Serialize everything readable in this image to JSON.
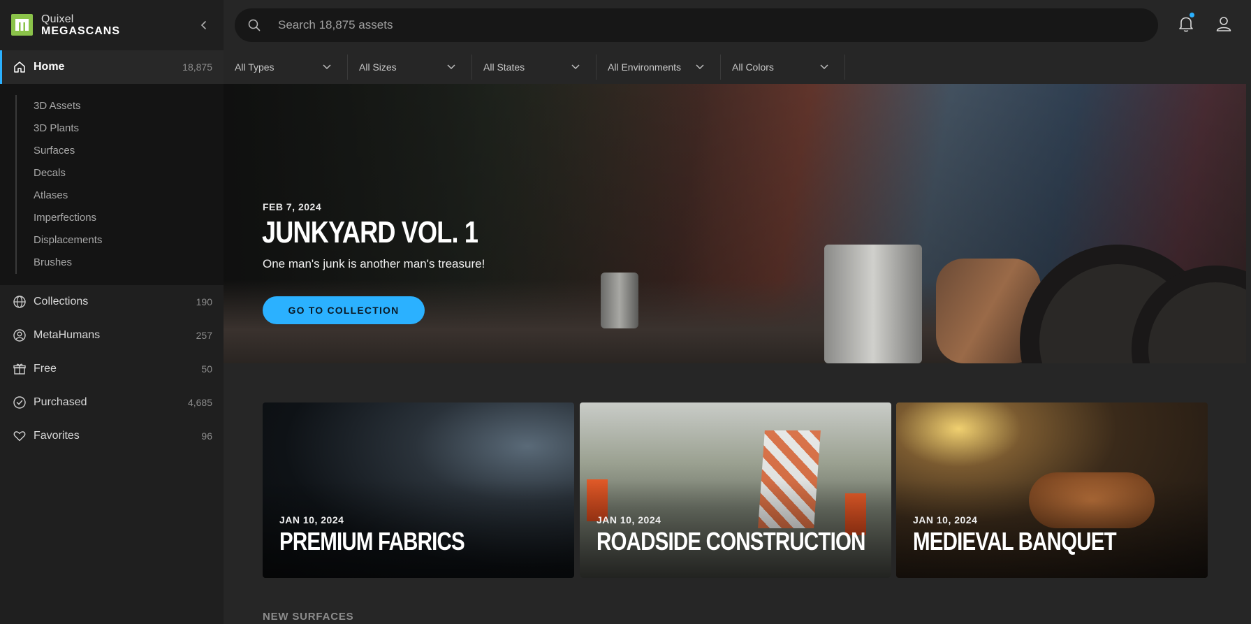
{
  "brand": {
    "line1": "Quixel",
    "line2": "MEGASCANS"
  },
  "search": {
    "placeholder": "Search 18,875 assets"
  },
  "sidebar": {
    "home": {
      "label": "Home",
      "count": "18,875"
    },
    "sub_items": [
      "3D Assets",
      "3D Plants",
      "Surfaces",
      "Decals",
      "Atlases",
      "Imperfections",
      "Displacements",
      "Brushes"
    ],
    "items": [
      {
        "label": "Collections",
        "count": "190",
        "icon": "globe-icon"
      },
      {
        "label": "MetaHumans",
        "count": "257",
        "icon": "person-circle-icon"
      },
      {
        "label": "Free",
        "count": "50",
        "icon": "gift-icon"
      },
      {
        "label": "Purchased",
        "count": "4,685",
        "icon": "check-circle-icon"
      },
      {
        "label": "Favorites",
        "count": "96",
        "icon": "heart-icon"
      }
    ]
  },
  "filters": [
    "All Types",
    "All Sizes",
    "All States",
    "All Environments",
    "All Colors"
  ],
  "hero": {
    "date": "FEB 7, 2024",
    "title": "JUNKYARD VOL. 1",
    "subtitle": "One man's junk is another man's treasure!",
    "button": "GO TO COLLECTION"
  },
  "cards": [
    {
      "date": "JAN 10, 2024",
      "title": "PREMIUM FABRICS"
    },
    {
      "date": "JAN 10, 2024",
      "title": "ROADSIDE CONSTRUCTION"
    },
    {
      "date": "JAN 10, 2024",
      "title": "MEDIEVAL BANQUET"
    }
  ],
  "section": {
    "title": "NEW SURFACES"
  },
  "colors": {
    "accent": "#2bb1ff",
    "logo": "#8bc34a"
  }
}
